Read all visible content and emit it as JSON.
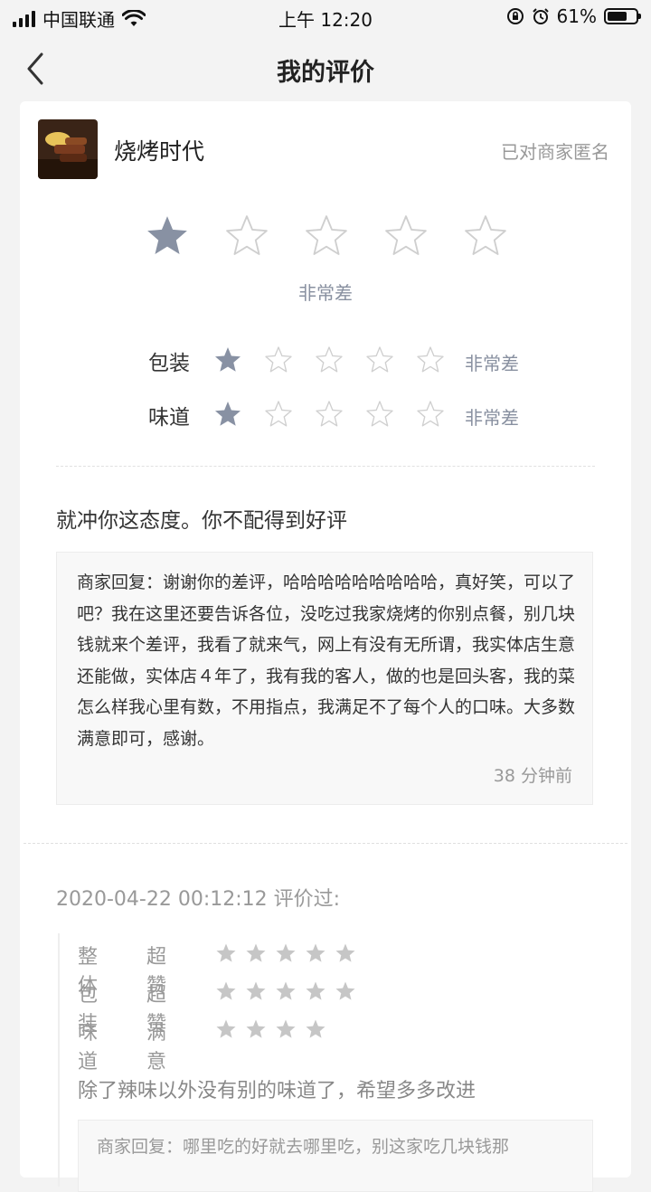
{
  "status_bar": {
    "carrier": "中国联通",
    "time": "上午 12:20",
    "battery": "61%"
  },
  "nav": {
    "title": "我的评价",
    "back_icon": "chevron-left-icon"
  },
  "shop": {
    "name": "烧烤时代",
    "anonymous_label": "已对商家匿名"
  },
  "overall": {
    "rating": 1,
    "max": 5,
    "label": "非常差"
  },
  "sub_ratings": [
    {
      "label": "包装",
      "rating": 1,
      "text": "非常差"
    },
    {
      "label": "味道",
      "rating": 1,
      "text": "非常差"
    }
  ],
  "review": {
    "comment": "就冲你这态度。你不配得到好评",
    "merchant_reply": "商家回复：谢谢你的差评，哈哈哈哈哈哈哈哈哈，真好笑，可以了吧？我在这里还要告诉各位，没吃过我家烧烤的你别点餐，别几块钱就来个差评，我看了就来气，网上有没有无所谓，我实体店生意还能做，实体店４年了，我有我的客人，做的也是回头客，我的菜怎么样我心里有数，不用指点，我满足不了每个人的口味。大多数满意即可，感谢。",
    "reply_time": "38 分钟前"
  },
  "history": {
    "header": "2020-04-22 00:12:12 评价过:",
    "ratings": [
      {
        "label": "整体",
        "level": "超赞",
        "stars": 5
      },
      {
        "label": "包装",
        "level": "超赞",
        "stars": 5
      },
      {
        "label": "味道",
        "level": "满意",
        "stars": 4
      }
    ],
    "comment": "除了辣味以外没有别的味道了，希望多多改进",
    "merchant_reply_preview": "商家回复：哪里吃的好就去哪里吃，别这家吃几块钱那"
  },
  "colors": {
    "star_filled": "#8891a3",
    "star_empty_outline": "#cfcfcf",
    "history_star": "#c6c6c6",
    "background": "#f3f3f3"
  }
}
